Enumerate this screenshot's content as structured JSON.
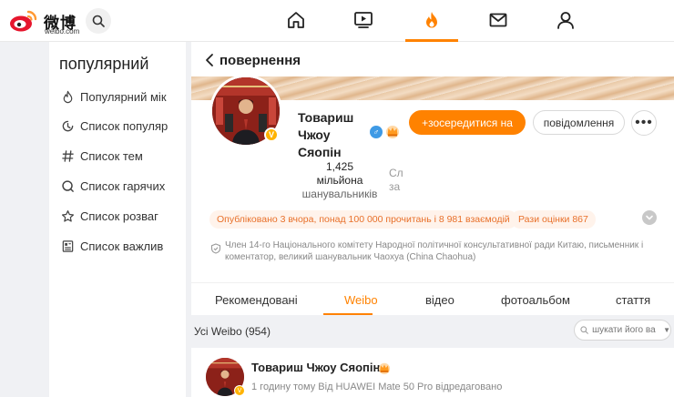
{
  "topbar": {
    "logo_title": "微博",
    "logo_sub": "weibo.com",
    "nav": [
      "home-icon",
      "video-icon",
      "hot-icon",
      "mail-icon",
      "profile-icon"
    ],
    "accent": "#ff8200"
  },
  "sidebar": {
    "title": "популярний",
    "items": [
      {
        "label": "Популярний мік",
        "icon": "flame-icon"
      },
      {
        "label": "Список популяр",
        "icon": "clock-icon"
      },
      {
        "label": "Список тем",
        "icon": "hashtag-icon"
      },
      {
        "label": "Список гарячих",
        "icon": "search-icon"
      },
      {
        "label": "Список розваг",
        "icon": "star-icon"
      },
      {
        "label": "Список важлив",
        "icon": "document-icon"
      }
    ]
  },
  "profile": {
    "back_label": "повернення",
    "name": "Товариш Чжоу Сяопін",
    "follow_label": "+зосередитися на",
    "message_label": "повідомлення",
    "more_label": "•••",
    "verified": "V",
    "gender": "♂",
    "followers_count": "1,425",
    "followers_unit": "мільйона",
    "followers_label": "шанувальників",
    "other_stat_line1": "Сл",
    "other_stat_line2": "за",
    "published_pill": "Опубліковано 3 вчора, понад 100 000 прочитань і 8 981 взаємодій",
    "rating_pill": "Рази оцінки 867",
    "description": "Член 14-го Національного комітету Народної політичної консультативної ради Китаю, письменник і коментатор, великий шанувальник Чаохуа (China Chaohua)"
  },
  "tabs": [
    {
      "label": "Рекомендовані",
      "active": false
    },
    {
      "label": "Weibo",
      "active": true
    },
    {
      "label": "відео",
      "active": false
    },
    {
      "label": "фотоальбом",
      "active": false
    },
    {
      "label": "стаття",
      "active": false
    }
  ],
  "feed": {
    "title": "Усі Weibo (954)",
    "search_placeholder": "шукати його ва"
  },
  "post": {
    "author": "Товариш Чжоу Сяопін",
    "meta": "1 годину тому  Від HUAWEI Mate 50 Pro відредаговано"
  }
}
